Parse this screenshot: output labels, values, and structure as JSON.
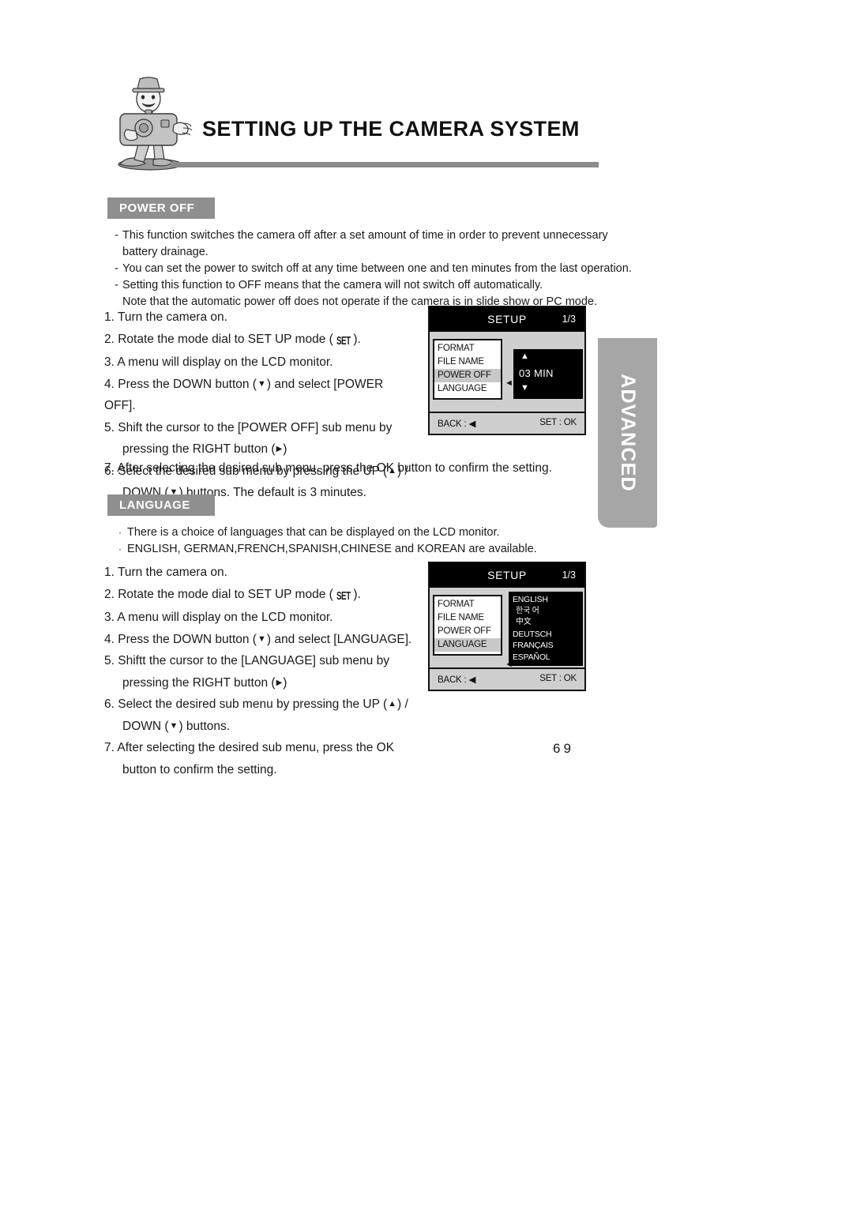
{
  "header": {
    "title": "SETTING UP THE CAMERA SYSTEM",
    "mascot_icon": "camera-mascot-illustration"
  },
  "side_tab": {
    "label": "ADVANCED",
    "color": "#a6a6a6"
  },
  "sections": {
    "power_off": {
      "badge": "POWER OFF",
      "badge_color": "#8f8f8f",
      "description": [
        {
          "marker": "-",
          "text": "This function switches the camera off after a set amount of time in order to prevent unnecessary",
          "indent": false
        },
        {
          "marker": "",
          "text": "battery drainage.",
          "indent": true
        },
        {
          "marker": "-",
          "text": "You can set the power to switch off at any time between one and ten minutes from the last operation.",
          "indent": false
        },
        {
          "marker": "-",
          "text": "Setting this function to OFF means that the camera will not switch off automatically.",
          "indent": false
        },
        {
          "marker": "",
          "text": "Note that the automatic power off does not operate if the camera is in slide show or PC mode.",
          "indent": true
        }
      ],
      "steps": [
        "1. Turn the camera on.",
        "2. Rotate the mode dial to SET UP mode (  ).",
        "3. A menu will display on the LCD monitor.",
        "4. Press the DOWN button (  ) and select [POWER",
        "OFF].",
        "5. Shift the cursor to the [POWER OFF] sub menu by",
        "pressing the RIGHT button (  )",
        "6. Select the desired sub menu by pressing the UP (  ) /",
        "DOWN (  ) buttons. The default is 3 minutes.",
        "7. After selecting the desired sub menu, press the OK button to confirm the setting."
      ],
      "step_parts": {
        "s1": "1. Turn the camera on.",
        "s2a": "2. Rotate the mode dial to SET UP mode (",
        "s2_icon": "SET",
        "s2b": ").",
        "s3": "3. A menu will display on the LCD monitor.",
        "s4a": "4. Press the DOWN button (",
        "s4b": ") and select [POWER",
        "s4c": "OFF].",
        "s5a": "5. Shift the cursor to the [POWER OFF] sub menu by",
        "s5b": "pressing the RIGHT button (",
        "s5c": ")",
        "s6a": "6. Select the desired sub menu by pressing the UP (",
        "s6b": ") /",
        "s6c": "DOWN (",
        "s6d": ") buttons. The default is 3 minutes.",
        "s7": "7. After selecting the desired sub menu, press the OK button to confirm the setting."
      }
    },
    "language": {
      "badge": "LANGUAGE",
      "badge_color": "#8f8f8f",
      "description": [
        {
          "marker": "·",
          "text": "There is a choice of languages that can be displayed on the LCD monitor."
        },
        {
          "marker": "·",
          "text": "ENGLISH, GERMAN,FRENCH,SPANISH,CHINESE and KOREAN are available."
        }
      ],
      "step_parts": {
        "s1": "1. Turn the camera on.",
        "s2a": "2. Rotate the mode dial to SET UP mode (",
        "s2_icon": "SET",
        "s2b": ").",
        "s3": "3. A menu will display on the LCD monitor.",
        "s4a": "4. Press the DOWN button (",
        "s4b": ") and select [LANGUAGE].",
        "s5a": "5. Shiftt the cursor to the [LANGUAGE] sub menu by",
        "s5b": "pressing the RIGHT button (",
        "s5c": ")",
        "s6a": "6. Select the desired sub menu by pressing the UP (",
        "s6b": ") /",
        "s6c": "DOWN (",
        "s6d": ") buttons.",
        "s7a": "7. After selecting the desired sub menu, press the OK",
        "s7b": "button to confirm the setting."
      }
    }
  },
  "lcd_power_off": {
    "title": "SETUP",
    "page_indicator": "1/3",
    "menu_items": [
      {
        "label": "FORMAT",
        "selected": false
      },
      {
        "label": "FILE NAME",
        "selected": false
      },
      {
        "label": "POWER OFF",
        "selected": true
      },
      {
        "label": "LANGUAGE",
        "selected": false
      }
    ],
    "cursor_icon": "left-triangle-cursor-icon",
    "submenu": {
      "up_arrow_icon": "up-triangle-icon",
      "value": "03  MIN",
      "down_arrow_icon": "down-triangle-icon"
    },
    "footer": {
      "back_label": "BACK : ◀",
      "set_label": "SET : OK"
    }
  },
  "lcd_language": {
    "title": "SETUP",
    "page_indicator": "1/3",
    "menu_items": [
      {
        "label": "FORMAT",
        "selected": false
      },
      {
        "label": "FILE NAME",
        "selected": false
      },
      {
        "label": "POWER OFF",
        "selected": false
      },
      {
        "label": "LANGUAGE",
        "selected": true
      }
    ],
    "cursor_icon": "left-triangle-cursor-icon",
    "language_options": [
      "ENGLISH",
      "한국 어",
      "中文",
      "DEUTSCH",
      "FRANÇAIS",
      "ESPAÑOL"
    ],
    "footer": {
      "back_label": "BACK : ◀",
      "set_label": "SET : OK"
    }
  },
  "page_number": "69"
}
